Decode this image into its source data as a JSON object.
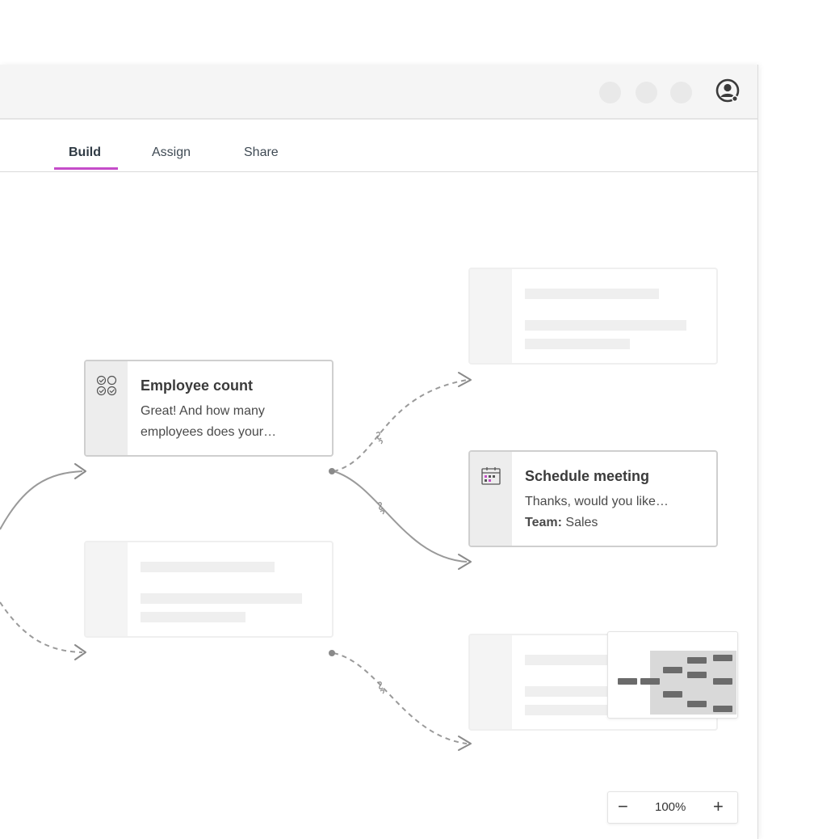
{
  "tabs": [
    {
      "label": "Build",
      "active": true
    },
    {
      "label": "Assign",
      "active": false
    },
    {
      "label": "Share",
      "active": false
    }
  ],
  "accent_color": "#c54cc9",
  "nodes": {
    "employee_count": {
      "icon": "checklist-icon",
      "title": "Employee count",
      "line1": "Great! And how many",
      "line2": "employees does your…"
    },
    "schedule_meeting": {
      "icon": "calendar-icon",
      "title": "Schedule meeting",
      "line1": "Thanks, would you like…",
      "team_label": "Team:",
      "team_value": "Sales"
    }
  },
  "zoom": {
    "minus": "−",
    "level": "100%",
    "plus": "+"
  }
}
